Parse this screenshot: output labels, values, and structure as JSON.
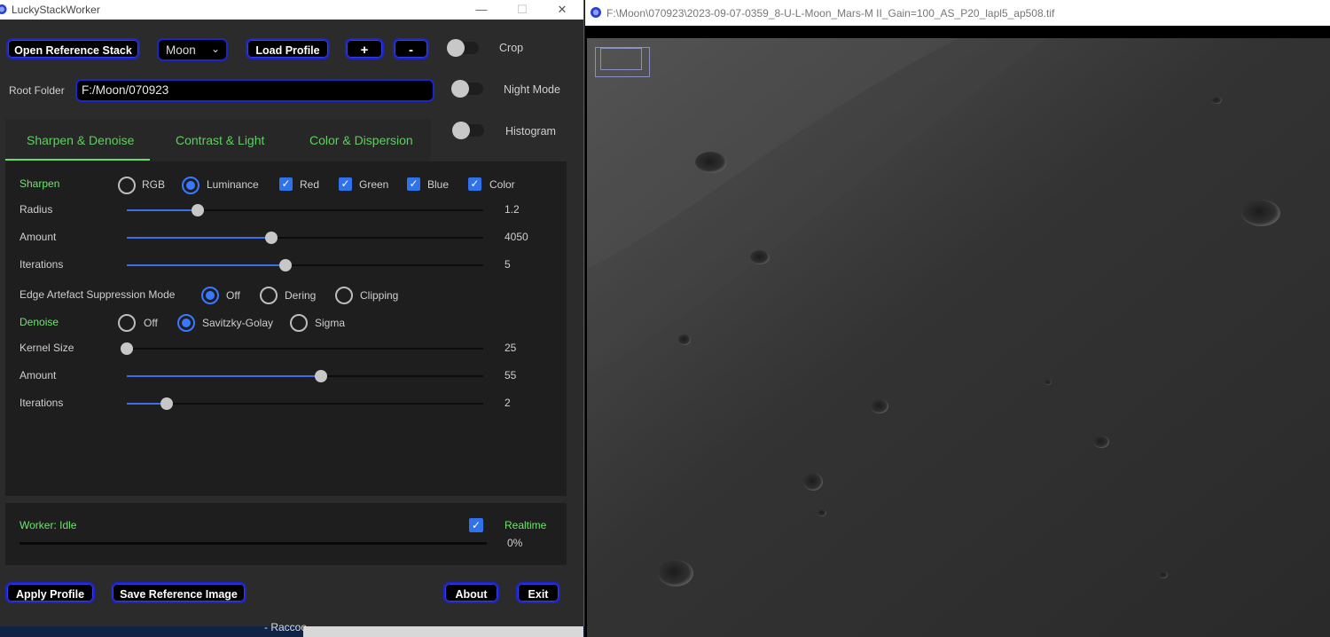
{
  "app": {
    "title": "LuckyStackWorker",
    "window_controls": {
      "minimize": "—",
      "maximize": "☐",
      "close": "✕"
    }
  },
  "toolbar": {
    "open_reference_stack": "Open Reference Stack",
    "profile_value": "Moon",
    "load_profile": "Load Profile",
    "plus": "+",
    "minus": "-",
    "crop_label": "Crop",
    "night_mode_label": "Night Mode",
    "histogram_label": "Histogram"
  },
  "root_folder": {
    "label": "Root Folder",
    "value": "F:/Moon/070923"
  },
  "tabs": [
    {
      "label": "Sharpen & Denoise",
      "active": true
    },
    {
      "label": "Contrast & Light",
      "active": false
    },
    {
      "label": "Color & Dispersion",
      "active": false
    }
  ],
  "sharpen": {
    "label": "Sharpen",
    "modes": [
      {
        "label": "RGB",
        "selected": false
      },
      {
        "label": "Luminance",
        "selected": true
      }
    ],
    "channels": [
      {
        "label": "Red",
        "checked": true
      },
      {
        "label": "Green",
        "checked": true
      },
      {
        "label": "Blue",
        "checked": true
      },
      {
        "label": "Color",
        "checked": true
      }
    ],
    "sliders": [
      {
        "label": "Radius",
        "value": "1.2",
        "fraction": 0.2
      },
      {
        "label": "Amount",
        "value": "4050",
        "fraction": 0.405
      },
      {
        "label": "Iterations",
        "value": "5",
        "fraction": 0.445
      }
    ]
  },
  "edge": {
    "label": "Edge Artefact Suppression Mode",
    "options": [
      {
        "label": "Off",
        "selected": true
      },
      {
        "label": "Dering",
        "selected": false
      },
      {
        "label": "Clipping",
        "selected": false
      }
    ]
  },
  "denoise": {
    "label": "Denoise",
    "options": [
      {
        "label": "Off",
        "selected": false
      },
      {
        "label": "Savitzky-Golay",
        "selected": true
      },
      {
        "label": "Sigma",
        "selected": false
      }
    ],
    "sliders": [
      {
        "label": "Kernel Size",
        "value": "25",
        "fraction": 0.0
      },
      {
        "label": "Amount",
        "value": "55",
        "fraction": 0.546
      },
      {
        "label": "Iterations",
        "value": "2",
        "fraction": 0.112
      }
    ]
  },
  "status": {
    "worker": "Worker: Idle",
    "realtime_label": "Realtime",
    "realtime_checked": true,
    "progress_text": "0%",
    "progress": 0
  },
  "bottom": {
    "apply_profile": "Apply Profile",
    "save_reference": "Save Reference Image",
    "about": "About",
    "exit": "Exit"
  },
  "taskbar": {
    "text": "- Raccoo"
  },
  "viewer": {
    "title": "F:\\Moon\\070923\\2023-09-07-0359_8-U-L-Moon_Mars-M II_Gain=100_AS_P20_lapl5_ap508.tif"
  },
  "colors": {
    "accent_border": "#1c25c7",
    "accent_blue": "#3a78ff",
    "green_text": "#6fe36f",
    "panel_bg": "#1e1e1e",
    "window_bg": "#2b2b2b"
  }
}
